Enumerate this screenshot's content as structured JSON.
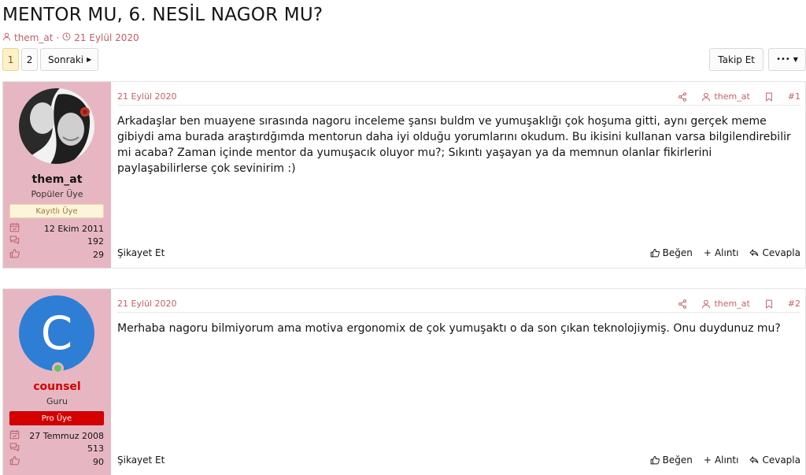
{
  "thread": {
    "title": "MENTOR MU, 6. NESİL NAGOR MU?",
    "author": "them_at",
    "date": "21 Eylül 2020"
  },
  "pager": {
    "pages": [
      "1",
      "2"
    ],
    "next": "Sonraki"
  },
  "actions": {
    "follow": "Takip Et",
    "more": "•••"
  },
  "posts": [
    {
      "user": {
        "name": "them_at",
        "title": "Popüler Üye",
        "banner": "Kayıtlı Üye",
        "joined": "12 Ekim 2011",
        "messages": "192",
        "reactions": "29"
      },
      "date": "21 Eylül 2020",
      "author_link": "them_at",
      "number": "#1",
      "body": "Arkadaşlar ben muayene sırasında nagoru inceleme şansı buldm ve yumuşaklığı çok hoşuma gitti, aynı gerçek meme gibiydi ama burada araştırdğımda mentorun daha iyi olduğu yorumlarını okudum. Bu ikisini kullanan varsa bilgilendirebilir mi acaba? Zaman içinde mentor da yumuşacık oluyor mu?; Sıkıntı yaşayan ya da memnun olanlar fikirlerini paylaşabilirlerse çok sevinirim :)",
      "report": "Şikayet Et",
      "like": "Beğen",
      "quote": "Alıntı",
      "reply": "Cevapla"
    },
    {
      "user": {
        "name": "counsel",
        "avatar_letter": "C",
        "title": "Guru",
        "banner": "Pro Üye",
        "joined": "27 Temmuz 2008",
        "messages": "513",
        "reactions": "90"
      },
      "date": "21 Eylül 2020",
      "author_link": "them_at",
      "number": "#2",
      "body": "Merhaba nagoru bilmiyorum ama motiva ergonomix de çok yumuşaktı o da son çıkan teknolojiymiş. Onu duydunuz mu?",
      "report": "Şikayet Et",
      "like": "Beğen",
      "quote": "Alıntı",
      "reply": "Cevapla"
    }
  ],
  "colors": {
    "accent": "#c0616a",
    "user_panel": "#e6b7c2",
    "avatar_blue": "#2f7ed6",
    "pro_red": "#d50000"
  }
}
